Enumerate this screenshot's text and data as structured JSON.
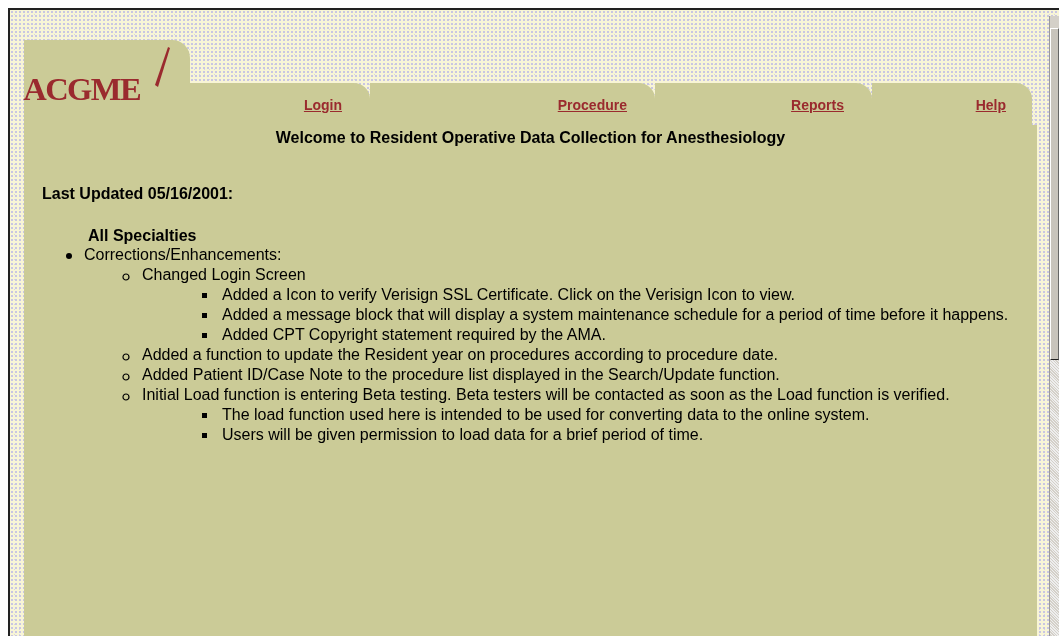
{
  "logo": {
    "text": "ACGME"
  },
  "tabs": [
    {
      "label": "Login"
    },
    {
      "label": "Procedure"
    },
    {
      "label": "Reports"
    },
    {
      "label": "Help"
    }
  ],
  "title": "Welcome to Resident Operative Data Collection for Anesthesiology",
  "last_updated": "Last Updated 05/16/2001:",
  "section": "All Specialties",
  "items": [
    {
      "text": "Corrections/Enhancements:",
      "children": [
        {
          "text": "Changed Login Screen",
          "children": [
            {
              "text": "Added a Icon to verify Verisign SSL Certificate. Click on the Verisign Icon to view."
            },
            {
              "text": "Added a message block that will display a system maintenance schedule for a period of time before it happens."
            },
            {
              "text": "Added CPT Copyright statement required by the AMA."
            }
          ]
        },
        {
          "text": "Added a function to update the Resident year on procedures according to procedure date."
        },
        {
          "text": "Added Patient ID/Case Note to the procedure list displayed in the Search/Update function."
        },
        {
          "text": "Initial Load function is entering Beta testing. Beta testers will be contacted as soon as the Load function is verified.",
          "children": [
            {
              "text": "The load function used here is intended to be used for converting data to the online system."
            },
            {
              "text": "Users will be given permission to load data for a brief period of time."
            }
          ]
        }
      ]
    }
  ]
}
